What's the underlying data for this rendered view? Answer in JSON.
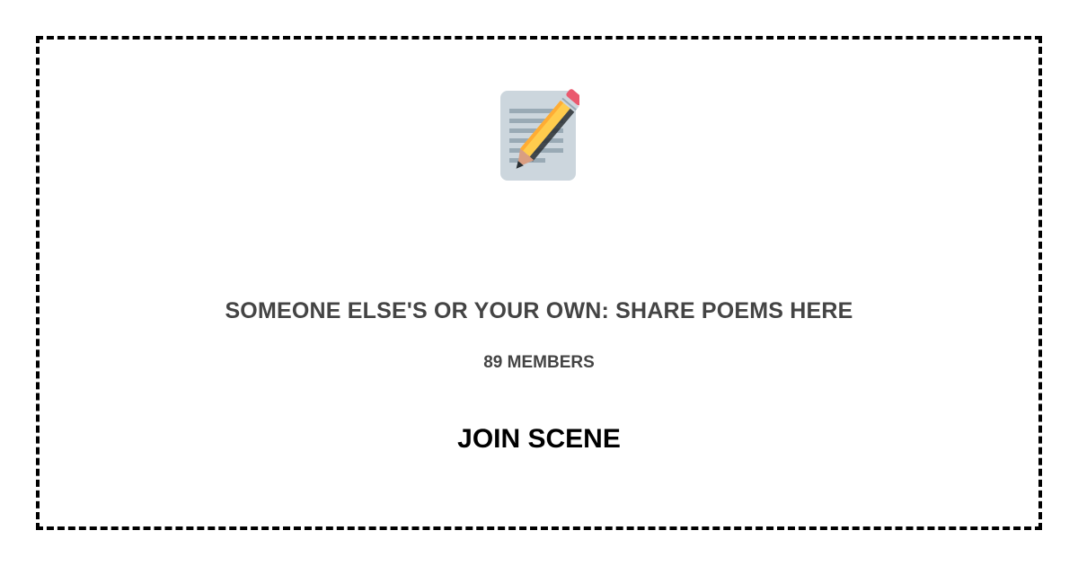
{
  "card": {
    "icon": "memo-pencil-icon",
    "title": "SOMEONE ELSE'S OR YOUR OWN: SHARE POEMS HERE",
    "members": "89 MEMBERS",
    "join_label": "JOIN SCENE"
  },
  "colors": {
    "border": "#000000",
    "text_muted": "#444444",
    "text_strong": "#000000",
    "icon_paper": "#CCD6DD",
    "icon_lines": "#99AAB5",
    "pencil_body": "#FFCC4D",
    "pencil_eraser": "#EA596E"
  }
}
